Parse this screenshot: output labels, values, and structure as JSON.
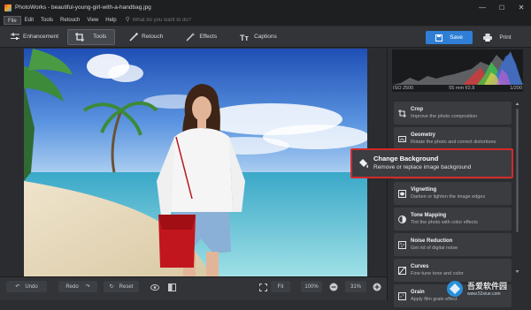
{
  "window": {
    "title": "PhotoWorks - beautiful-young-girl-with-a-handbag.jpg",
    "minimize": "—",
    "maximize": "☐",
    "close": "✕"
  },
  "menu": {
    "items": [
      "File",
      "Edit",
      "Tools",
      "Retouch",
      "View",
      "Help"
    ],
    "search_placeholder": "What do you want to do?"
  },
  "toolbar": {
    "tabs": [
      "Enhancement",
      "Tools",
      "Retouch",
      "Effects",
      "Captions"
    ],
    "active_tab": "Tools",
    "save_label": "Save",
    "print_label": "Print"
  },
  "histogram": {
    "iso": "ISO 2500",
    "lens": "55 mm f/2.8",
    "shutter": "1/200"
  },
  "tools_panel": {
    "items": [
      {
        "title": "Crop",
        "desc": "Improve the photo composition",
        "icon": "crop-icon"
      },
      {
        "title": "Geometry",
        "desc": "Rotate the photo and correct distortions",
        "icon": "geometry-icon"
      },
      {
        "title": "Change Background",
        "desc": "Remove or replace image background",
        "icon": "paint-bucket-icon"
      },
      {
        "title": "Vignetting",
        "desc": "Darken or lighten the image edges",
        "icon": "vignette-icon"
      },
      {
        "title": "Tone Mapping",
        "desc": "Tint the photo with color effects",
        "icon": "tone-icon"
      },
      {
        "title": "Noise Reduction",
        "desc": "Get rid of digital noise",
        "icon": "noise-icon"
      },
      {
        "title": "Curves",
        "desc": "Fine-tune tone and color",
        "icon": "curves-icon"
      },
      {
        "title": "Grain",
        "desc": "Apply film grain effect",
        "icon": "grain-icon"
      }
    ]
  },
  "bottombar": {
    "undo": "Undo",
    "redo": "Redo",
    "reset": "Reset",
    "fit": "Fit",
    "zoom_preset": "100%",
    "zoom_level": "31%"
  },
  "watermark": {
    "text": "吾爱软件园",
    "url": "www.52xiue.com"
  },
  "colors": {
    "accent": "#2f7fd6",
    "highlight_border": "#d22a2a"
  }
}
